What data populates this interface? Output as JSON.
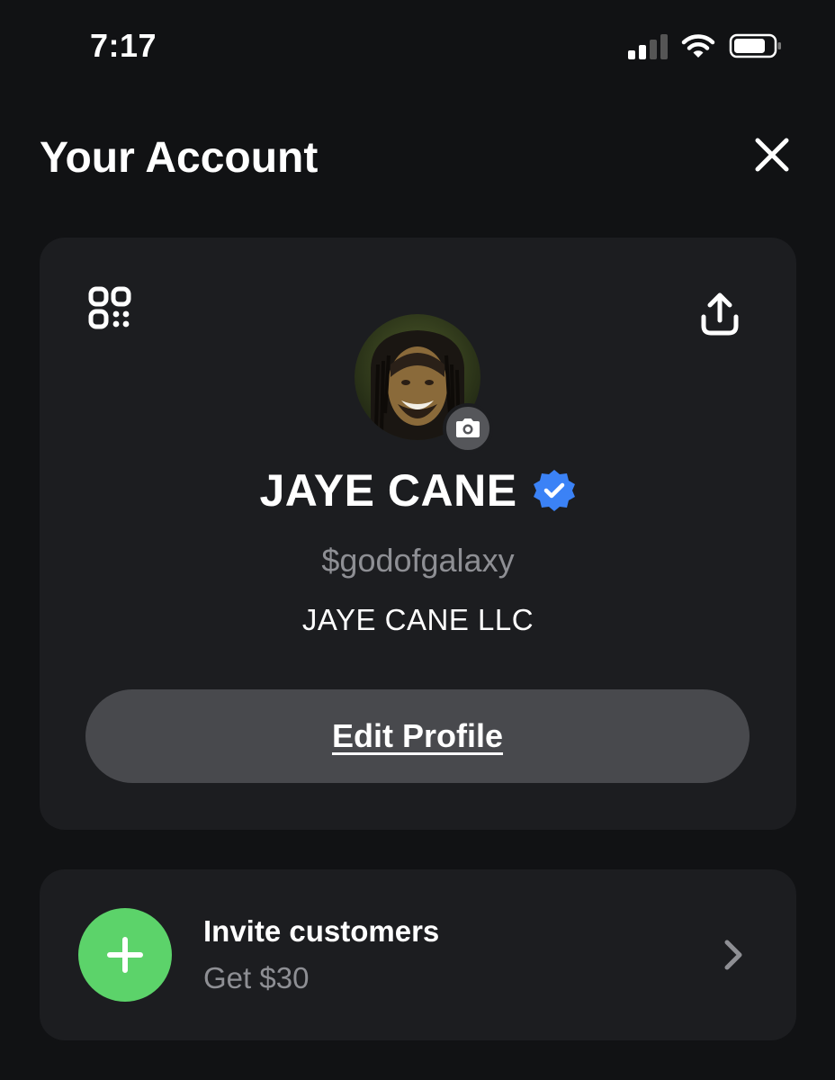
{
  "status_bar": {
    "time": "7:17"
  },
  "header": {
    "title": "Your Account"
  },
  "profile": {
    "display_name": "JAYE CANE",
    "cashtag": "$godofgalaxy",
    "business_name": "JAYE CANE LLC",
    "verified": true,
    "edit_button_label": "Edit Profile"
  },
  "invite": {
    "title": "Invite customers",
    "subtitle": "Get $30"
  },
  "icons": {
    "close": "close-icon",
    "qr": "qr-code-icon",
    "share": "share-icon",
    "camera": "camera-icon",
    "verified": "verified-badge-icon",
    "plus": "plus-icon",
    "chevron": "chevron-right-icon"
  },
  "colors": {
    "background": "#111214",
    "card": "#1c1d20",
    "button": "#48494d",
    "accent_green": "#5cd36a",
    "verified_blue": "#3b82f6",
    "muted_text": "#8e8f94"
  }
}
